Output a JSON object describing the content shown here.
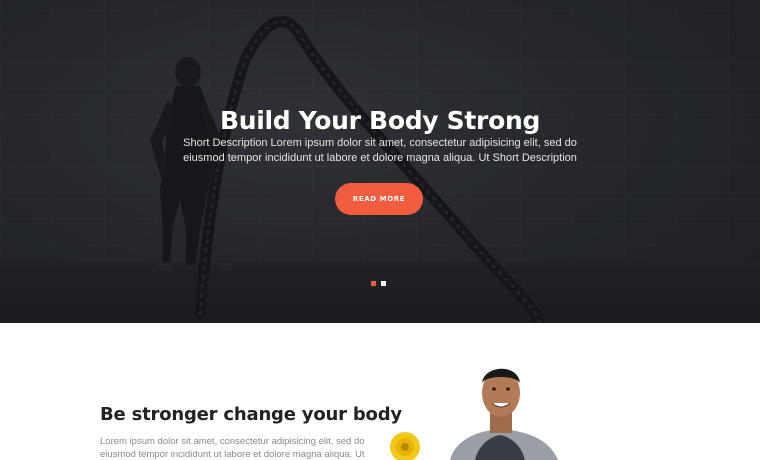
{
  "hero": {
    "title": "Build Your Body Strong",
    "description": "Short Description Lorem ipsum dolor sit amet, consectetur adipisicing elit, sed do eiusmod tempor incididunt ut labore et dolore magna aliqua. Ut Short Description",
    "button_label": "READ MORE",
    "slides_total": 2,
    "active_slide": 1
  },
  "about": {
    "heading": "Be stronger change your body",
    "text": "Lorem ipsum dolor sit amet, consectetur adipisicing elit, sed do eiusmod tempor incididunt ut labore et dolore magna aliqua. Ut enim"
  },
  "colors": {
    "accent": "#f25c3f",
    "hero_bg": "#2b2e33",
    "heading": "#222222",
    "body_text": "#8a8a8a"
  }
}
